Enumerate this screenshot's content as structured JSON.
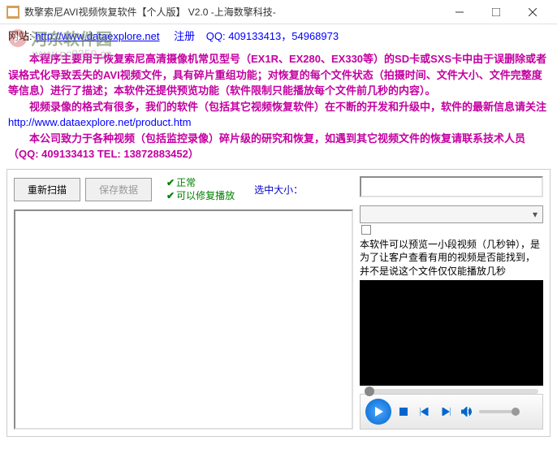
{
  "title": "数擎索尼AVI视频恢复软件【个人版】 V2.0  -上海数擎科技-",
  "header": {
    "site_label": "网站:",
    "site_url": "http://www.dataexplore.net",
    "register": "注册",
    "qq_label": "QQ:",
    "qq_numbers": "409133413，54968973"
  },
  "watermark": {
    "text1": "河东软件园",
    "text2": "www.pc0359.cn"
  },
  "description": {
    "p1": "　　本程序主要用于恢复索尼高清摄像机常见型号（EX1R、EX280、EX330等）的SD卡或SXS卡中由于误删除或者误格式化导致丢失的AVI视频文件，具有碎片重组功能；对恢复的每个文件状态（拍摄时间、文件大小、文件完整度等信息）进行了描述；本软件还提供预览功能（软件限制只能播放每个文件前几秒的内容）。",
    "p2_a": "　　视频录像的格式有很多，我们的软件（包括其它视频恢复软件）在不断的开发和升级中，软件的最新信息请关注 ",
    "p2_link": "http://www.dataexplore.net/product.htm",
    "p3": "　　本公司致力于各种视频（包括监控录像）碎片级的研究和恢复，如遇到其它视频文件的恢复请联系技术人员（QQ: 409133413 TEL: 13872883452）"
  },
  "buttons": {
    "rescan": "重新扫描",
    "save": "保存数据"
  },
  "legend": {
    "normal": "正常",
    "repair": "可以修复播放"
  },
  "selected_size_label": "选中大小：",
  "preview_note": "本软件可以预览一小段视频（几秒钟），是为了让客户查看有用的视频是否能找到，并不是说这个文件仅仅能播放几秒",
  "player": {}
}
